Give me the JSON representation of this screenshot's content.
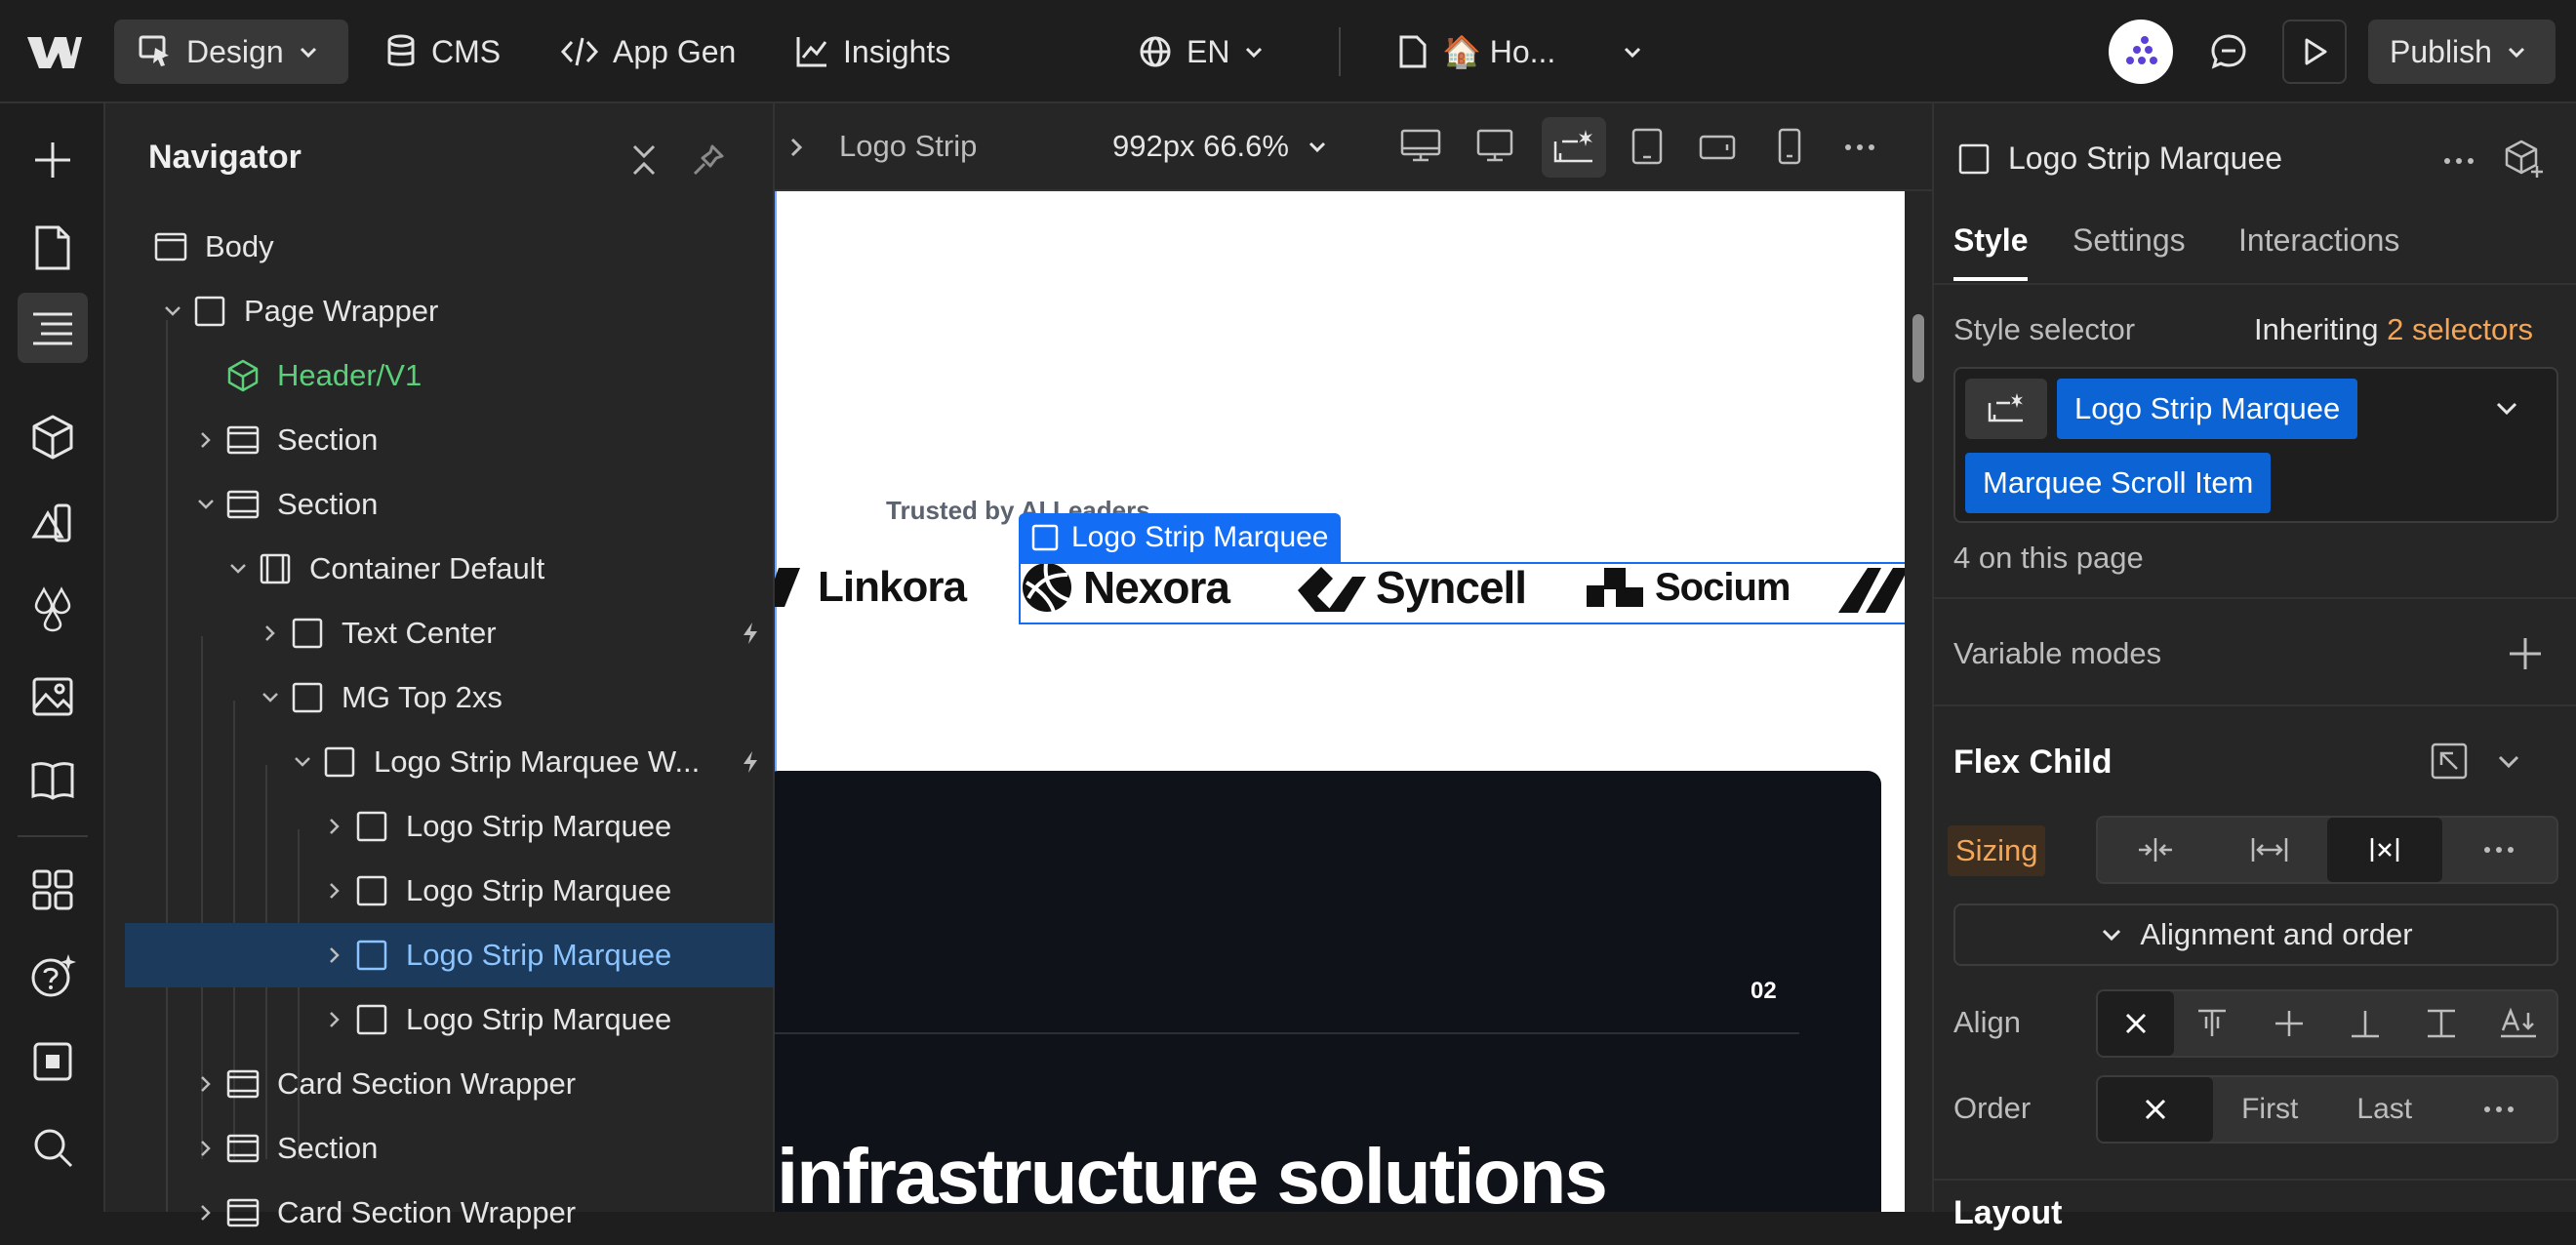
{
  "topbar": {
    "mode": "Design",
    "cms": "CMS",
    "app_gen": "App Gen",
    "insights": "Insights",
    "language": "EN",
    "page": "🏠 Ho...",
    "publish": "Publish"
  },
  "navigator": {
    "title": "Navigator",
    "items": [
      {
        "label": "Body"
      },
      {
        "label": "Page Wrapper"
      },
      {
        "label": "Header/V1"
      },
      {
        "label": "Section"
      },
      {
        "label": "Section"
      },
      {
        "label": "Container Default"
      },
      {
        "label": "Text Center"
      },
      {
        "label": "MG Top 2xs"
      },
      {
        "label": "Logo Strip Marquee W..."
      },
      {
        "label": "Logo Strip Marquee"
      },
      {
        "label": "Logo Strip Marquee"
      },
      {
        "label": "Logo Strip Marquee"
      },
      {
        "label": "Logo Strip Marquee"
      },
      {
        "label": "Card Section Wrapper"
      },
      {
        "label": "Section"
      },
      {
        "label": "Card Section Wrapper"
      }
    ]
  },
  "canvas_bar": {
    "breadcrumb": "Logo Strip",
    "size": "992px 66.6%"
  },
  "canvas": {
    "trusted": "Trusted by AI Leaders",
    "selection_label": "Logo Strip Marquee",
    "logos": [
      "Linkora",
      "Nexora",
      "Syncell",
      "Socium"
    ],
    "number": "02",
    "headline": "infrastructure solutions"
  },
  "right_panel": {
    "element": "Logo Strip Marquee",
    "tabs": [
      "Style",
      "Settings",
      "Interactions"
    ],
    "style_selector": "Style selector",
    "inheriting": "Inheriting",
    "selectors_count": "2 selectors",
    "selector_tags": [
      "Logo Strip Marquee",
      "Marquee Scroll Item"
    ],
    "on_page": "4 on this page",
    "variable_modes": "Variable modes",
    "flex_child": "Flex Child",
    "sizing": "Sizing",
    "alignment_order": "Alignment and order",
    "align": "Align",
    "order": "Order",
    "order_first": "First",
    "order_last": "Last",
    "layout": "Layout"
  },
  "colors": {
    "accent": "#0d6fe6",
    "selector_tag": "#0b63d4",
    "orange": "#f2a65a",
    "component_green": "#5ccf7a",
    "selected_row": "#1b3a5c"
  }
}
